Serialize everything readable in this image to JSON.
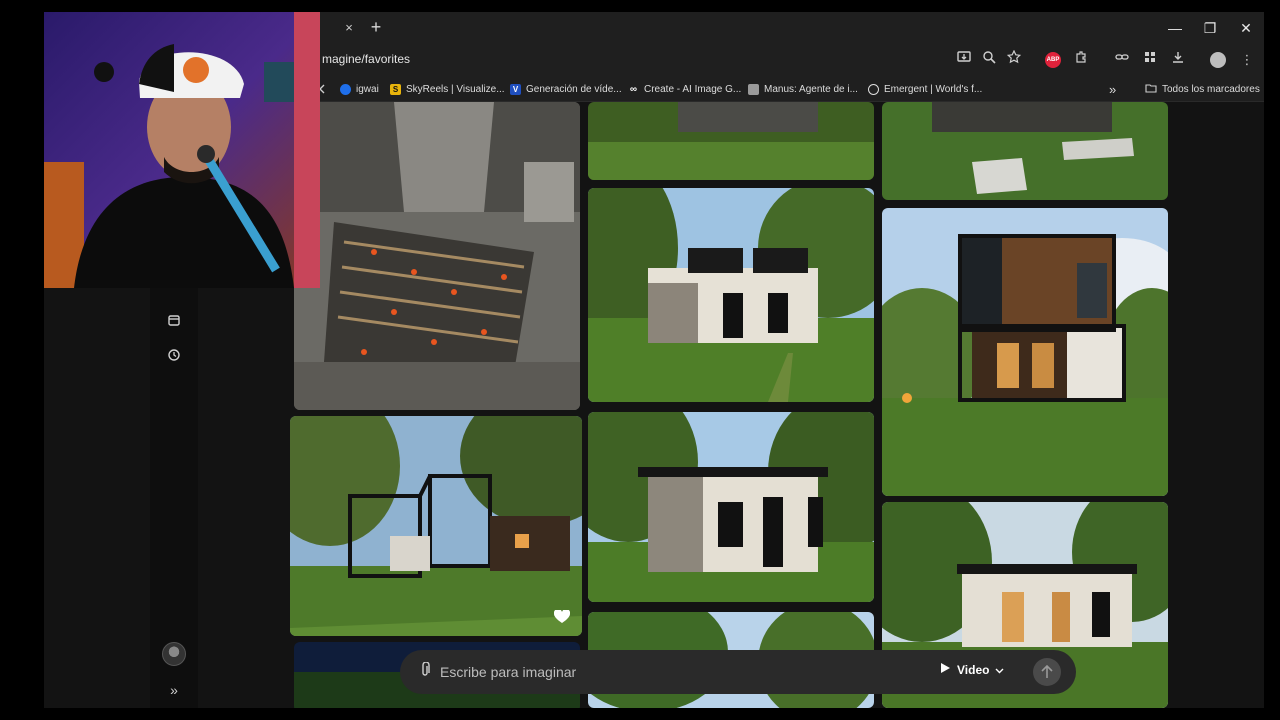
{
  "browser": {
    "url": "magine/favorites",
    "tab_close": "×",
    "new_tab": "+",
    "minimize": "—",
    "restore": "❐",
    "close": "✕",
    "bookmarks": [
      {
        "label": "igwai",
        "icon": "globe-icon",
        "color": "#4aa3ff"
      },
      {
        "label": "SkyReels | Visualize...",
        "icon": "s-logo-icon",
        "color": "#f0c419"
      },
      {
        "label": "Generación de víde...",
        "icon": "v-logo-icon",
        "color": "#1f6feb"
      },
      {
        "label": "Create - AI Image G...",
        "icon": "loop-logo-icon",
        "color": "#ffffff"
      },
      {
        "label": "Manus: Agente de i...",
        "icon": "manus-logo-icon",
        "color": "#cccccc"
      },
      {
        "label": "Emergent | World's f...",
        "icon": "e-logo-icon",
        "color": "#ffffff"
      }
    ],
    "bookmarks_overflow": "»",
    "all_bookmarks": "Todos los marcadores"
  },
  "prompt": {
    "placeholder": "Escribe para imaginar",
    "mode_label": "Video",
    "mode_icon": "play-icon",
    "send_icon": "arrow-up-icon"
  },
  "sidebar": {
    "expand": "»"
  }
}
